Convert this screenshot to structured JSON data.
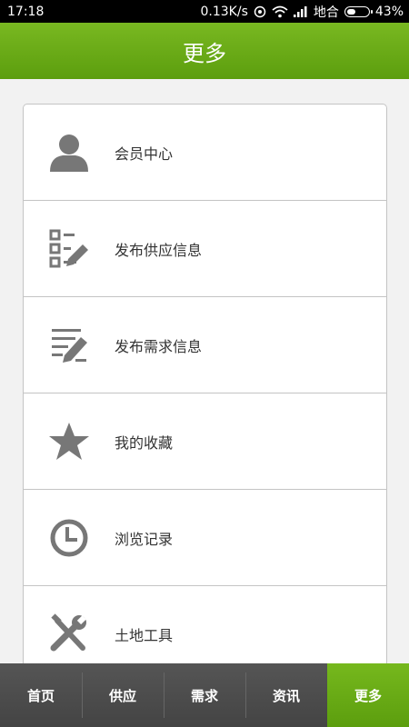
{
  "status_bar": {
    "time": "17:18",
    "net_speed": "0.13K/s",
    "carrier": "地合",
    "battery": "43%",
    "battery_level": 0.43,
    "icons": [
      "alarm-icon",
      "wifi-icon",
      "signal-icon",
      "battery-icon"
    ]
  },
  "header": {
    "title": "更多"
  },
  "menu": {
    "items": [
      {
        "label": "会员中心",
        "icon": "person-icon"
      },
      {
        "label": "发布供应信息",
        "icon": "checklist-edit-icon"
      },
      {
        "label": "发布需求信息",
        "icon": "list-edit-icon"
      },
      {
        "label": "我的收藏",
        "icon": "star-icon"
      },
      {
        "label": "浏览记录",
        "icon": "clock-icon"
      },
      {
        "label": "土地工具",
        "icon": "tools-icon"
      }
    ],
    "icon_color": "#777777"
  },
  "tab_bar": {
    "tabs": [
      {
        "label": "首页"
      },
      {
        "label": "供应"
      },
      {
        "label": "需求"
      },
      {
        "label": "资讯"
      },
      {
        "label": "更多"
      }
    ],
    "active_index": 4,
    "active_color": "#6aab16"
  }
}
